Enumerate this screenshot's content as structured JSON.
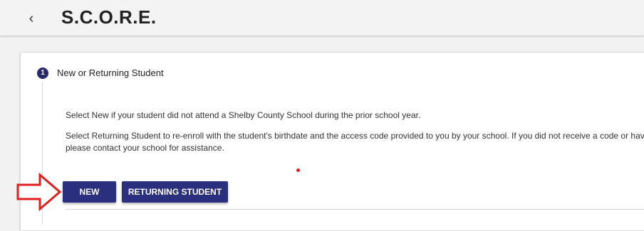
{
  "header": {
    "back_icon": "chevron-left-icon",
    "back_glyph": "‹",
    "title": "S.C.O.R.E."
  },
  "stepper": {
    "step_number": "1",
    "step_label": "New or Returning Student",
    "accent_color": "#262a6b"
  },
  "content": {
    "line1": "Select New if your student did not attend a Shelby County School during the prior school year.",
    "line2": "Select Returning Student to re-enroll with the student's birthdate and the access code provided to you by your school. If you did not receive a code or hav",
    "line3": "please contact your school for assistance."
  },
  "buttons": {
    "new_label": "NEW",
    "returning_label": "RETURNING STUDENT",
    "color": "#2a2f7e"
  },
  "annotation": {
    "arrow_icon": "arrow-right-outline-icon",
    "arrow_color": "#e02020"
  }
}
